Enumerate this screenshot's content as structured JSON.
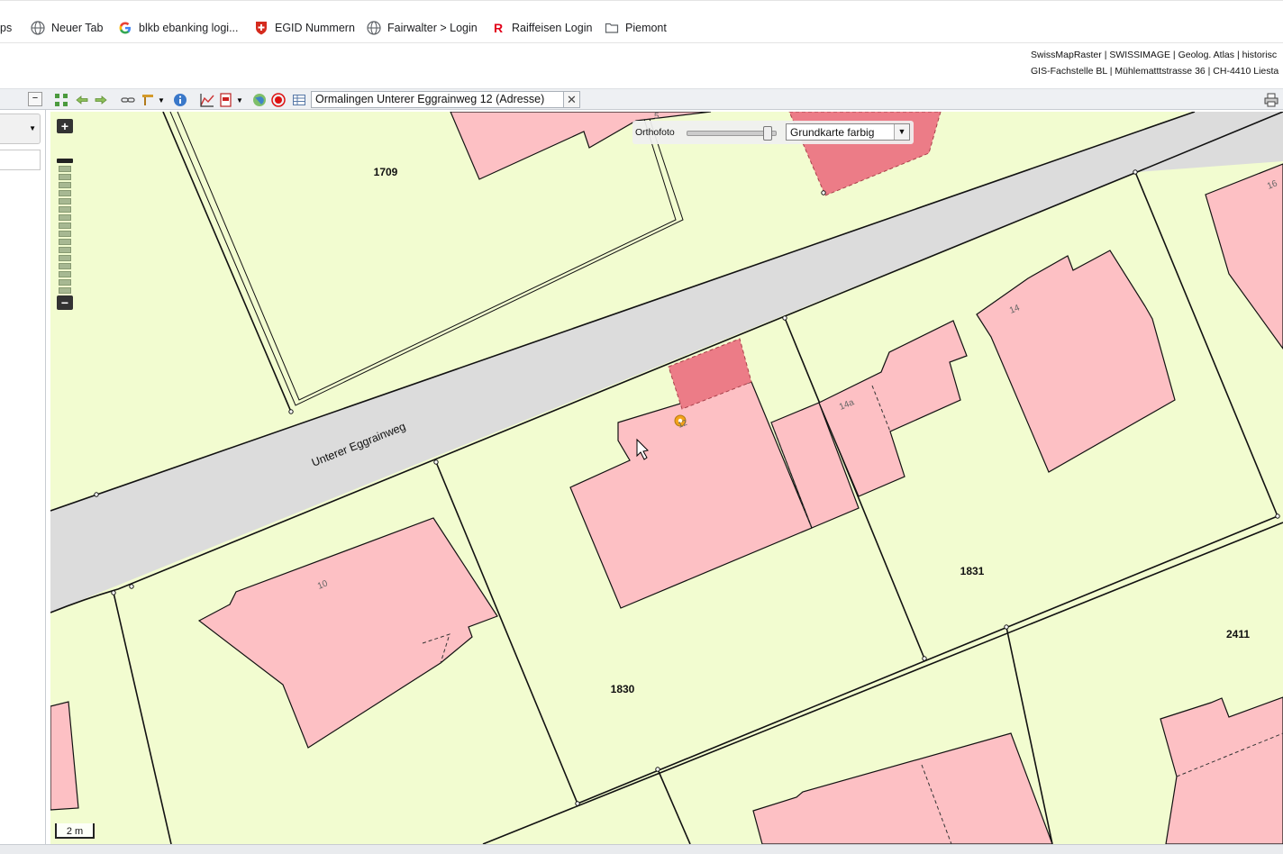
{
  "bookmarks": [
    {
      "label": "ps",
      "icon": "none"
    },
    {
      "label": "Neuer Tab",
      "icon": "globe-icon"
    },
    {
      "label": "blkb ebanking logi...",
      "icon": "google-icon"
    },
    {
      "label": "EGID Nummern",
      "icon": "swiss-shield-icon"
    },
    {
      "label": "Fairwalter > Login",
      "icon": "globe-icon"
    },
    {
      "label": "Raiffeisen Login",
      "icon": "raiffeisen-icon"
    },
    {
      "label": "Piemont",
      "icon": "folder-icon"
    }
  ],
  "header": {
    "line1": "SwissMapRaster | SWISSIMAGE | Geolog. Atlas | historisc",
    "line2": "GIS-Fachstelle BL | Mühlematttstrasse 36 | CH-4410 Liesta"
  },
  "toolbar": {
    "search_value": "Ormalingen Unterer Eggrainweg 12 (Adresse)",
    "clear_label": "✕"
  },
  "layer_control": {
    "ortho_label": "Orthofoto",
    "ortho_opacity": 0.95,
    "basemap_selected": "Grundkarte farbig",
    "basemap_arrow": "▼"
  },
  "zoom": {
    "plus": "+",
    "minus": "−",
    "level_fraction": 0.05
  },
  "map": {
    "street_name": "Unterer Eggrainweg",
    "parcels": [
      "1709",
      "1830",
      "1831",
      "2411"
    ],
    "house_numbers": [
      "5",
      "16",
      "14",
      "14a",
      "12",
      "10"
    ],
    "scale_label": "2 m",
    "colors": {
      "land": "#f2fcd0",
      "street": "#dcdcdc",
      "building": "#fdc0c4",
      "highlight": "#ec7c87",
      "marker": "#f3a21a"
    }
  }
}
